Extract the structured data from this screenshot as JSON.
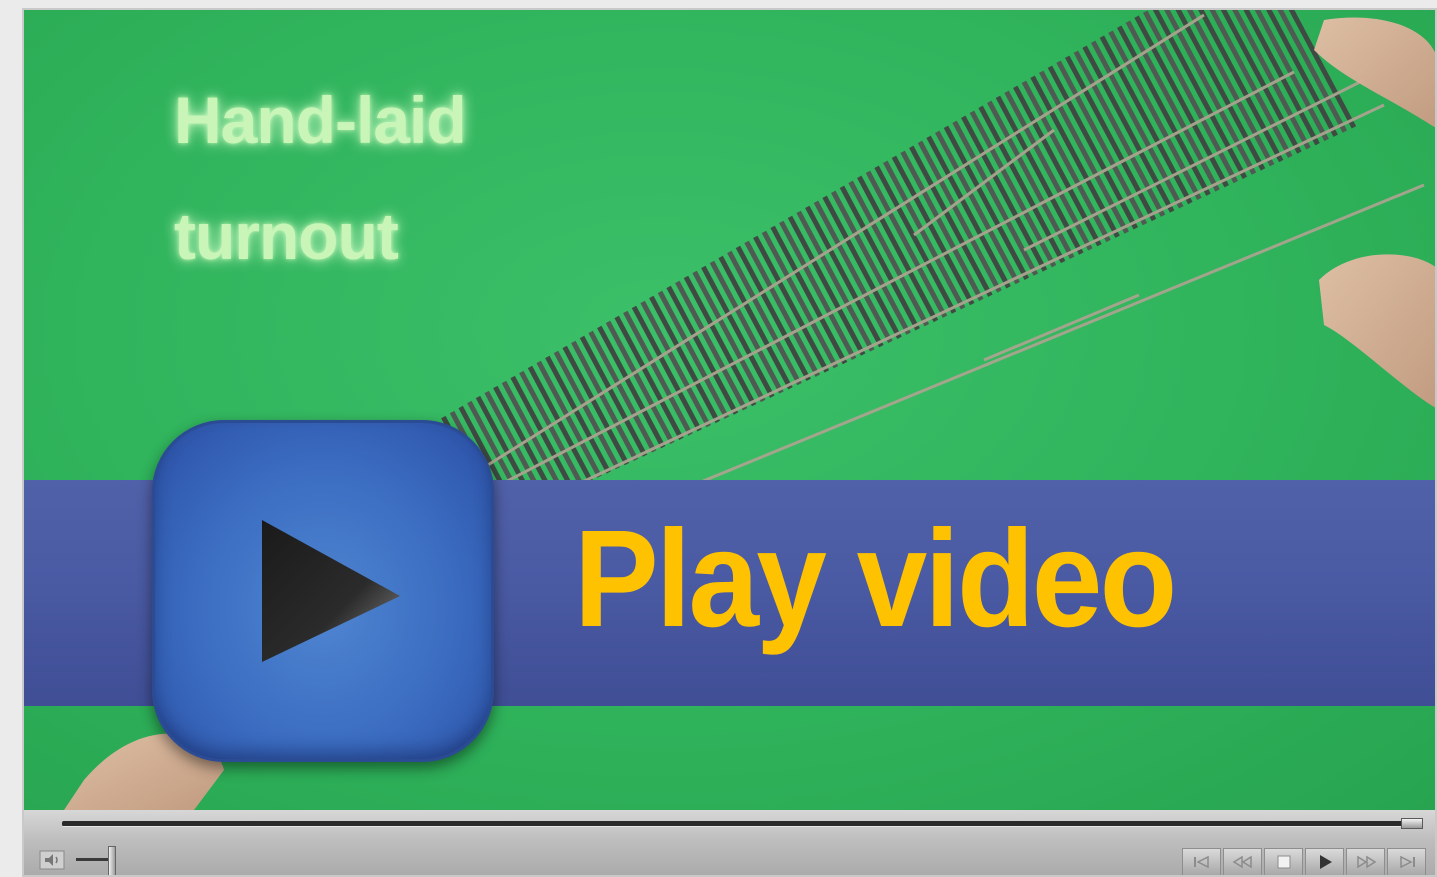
{
  "video": {
    "title_line_1": "Hand-laid",
    "title_line_2": "turnout",
    "banner_label": "Play video"
  },
  "player": {
    "seek_progress": 1.0,
    "volume_level": 0.9,
    "transport_buttons": [
      "skip-back-icon",
      "rewind-icon",
      "stop-icon",
      "play-icon",
      "fast-forward-icon",
      "skip-forward-icon"
    ]
  },
  "colors": {
    "background_green": "#2fb35b",
    "banner_blue": "#4a5aa3",
    "banner_text": "#ffc200",
    "title_text": "#c9f5b9",
    "play_button_blue": "#3a6bc0"
  }
}
